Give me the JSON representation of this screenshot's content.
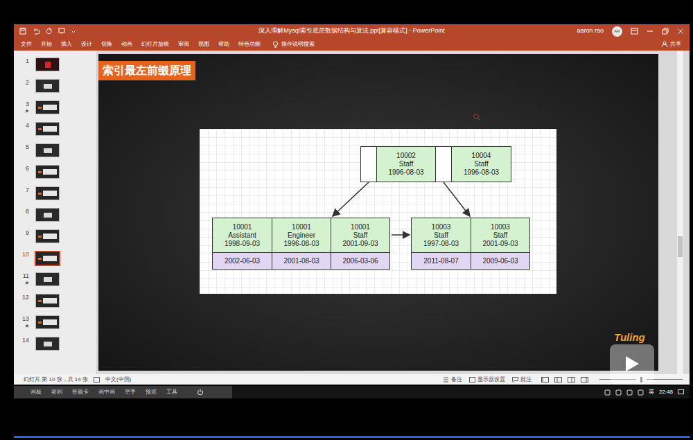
{
  "window": {
    "title": "深入理解Mysql索引底层数据结构与算法.ppt[兼容模式] - PowerPoint",
    "user": "aaron rao",
    "avatar": "AR"
  },
  "ribbon": {
    "tabs": [
      "文件",
      "开始",
      "插入",
      "设计",
      "切换",
      "动画",
      "幻灯片放映",
      "审阅",
      "视图",
      "帮助",
      "特色功能"
    ],
    "search": "操作说明搜索",
    "share": "共享"
  },
  "slides": [
    {
      "number": "1",
      "animated": false,
      "selected": false
    },
    {
      "number": "2",
      "animated": false,
      "selected": false
    },
    {
      "number": "3",
      "animated": true,
      "selected": false
    },
    {
      "number": "4",
      "animated": false,
      "selected": false
    },
    {
      "number": "5",
      "animated": false,
      "selected": false
    },
    {
      "number": "6",
      "animated": false,
      "selected": false
    },
    {
      "number": "7",
      "animated": false,
      "selected": false
    },
    {
      "number": "8",
      "animated": false,
      "selected": false
    },
    {
      "number": "9",
      "animated": false,
      "selected": false
    },
    {
      "number": "10",
      "animated": false,
      "selected": true
    },
    {
      "number": "11",
      "animated": true,
      "selected": false
    },
    {
      "number": "12",
      "animated": false,
      "selected": false
    },
    {
      "number": "13",
      "animated": true,
      "selected": false
    },
    {
      "number": "14",
      "animated": false,
      "selected": false
    }
  ],
  "slide": {
    "title": "索引最左前缀原理",
    "diagram": {
      "root": [
        {
          "id": "10002",
          "title": "Staff",
          "date": "1996-08-03"
        },
        {
          "id": "10004",
          "title": "Staff",
          "date": "1996-08-03"
        }
      ],
      "leaves": [
        [
          {
            "id": "10001",
            "title": "Assistant",
            "date": "1998-09-03",
            "value": "2002-06-03"
          },
          {
            "id": "10001",
            "title": "Engineer",
            "date": "1996-08-03",
            "value": "2001-08-03"
          },
          {
            "id": "10001",
            "title": "Staff",
            "date": "2001-09-03",
            "value": "2006-03-06"
          }
        ],
        [
          {
            "id": "10003",
            "title": "Staff",
            "date": "1997-08-03",
            "value": "2011-08-07"
          },
          {
            "id": "10003",
            "title": "Staff",
            "date": "2001-09-03",
            "value": "2009-06-03"
          }
        ]
      ]
    }
  },
  "status_bar": {
    "slide_position": "幻灯片 第 10 张，共 14 张",
    "language": "中文(中国)",
    "notes": "备注",
    "display_settings": "显示器设置",
    "comments": "批注"
  },
  "taskbar": {
    "items": [
      "画板",
      "签到",
      "答题卡",
      "画中画",
      "举手",
      "预览",
      "工具"
    ],
    "input_method": "英",
    "time": "22:48"
  },
  "watermark": "Tuling"
}
